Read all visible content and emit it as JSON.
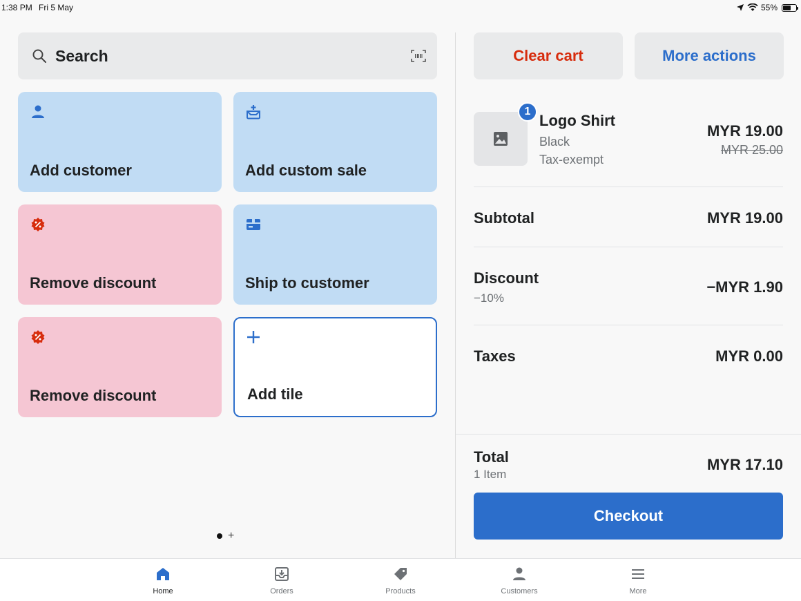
{
  "status_bar": {
    "time": "1:38 PM",
    "date": "Fri 5 May",
    "battery": "55%"
  },
  "search": {
    "label": "Search"
  },
  "tiles": [
    {
      "label": "Add customer",
      "color": "#c1dcf4",
      "icon": "person-icon"
    },
    {
      "label": "Add custom sale",
      "color": "#c1dcf4",
      "icon": "add-to-basket-icon"
    },
    {
      "label": "Remove discount",
      "color": "#f5c6d3",
      "icon": "discount-badge-icon"
    },
    {
      "label": "Ship to customer",
      "color": "#c1dcf4",
      "icon": "shipping-icon"
    },
    {
      "label": "Remove discount",
      "color": "#f5c6d3",
      "icon": "discount-badge-icon"
    },
    {
      "label": "Add tile",
      "color": "#ffffff",
      "icon": "plus-icon"
    }
  ],
  "pager": {
    "plus": "+"
  },
  "cart_actions": {
    "clear_cart": "Clear cart",
    "more_actions": "More actions"
  },
  "cart_item": {
    "quantity": "1",
    "name": "Logo Shirt",
    "variant": "Black",
    "tax": "Tax-exempt",
    "price": "MYR 19.00",
    "original_price": "MYR 25.00"
  },
  "summary": {
    "subtotal_label": "Subtotal",
    "subtotal_value": "MYR 19.00",
    "discount_label": "Discount",
    "discount_sub": "−10%",
    "discount_value": "−MYR 1.90",
    "taxes_label": "Taxes",
    "taxes_value": "MYR 0.00",
    "total_label": "Total",
    "total_sub": "1 Item",
    "total_value": "MYR 17.10"
  },
  "checkout": {
    "label": "Checkout"
  },
  "tabs": [
    {
      "label": "Home",
      "icon": "home-icon",
      "active": true
    },
    {
      "label": "Orders",
      "icon": "orders-icon",
      "active": false
    },
    {
      "label": "Products",
      "icon": "tag-icon",
      "active": false
    },
    {
      "label": "Customers",
      "icon": "person-icon",
      "active": false
    },
    {
      "label": "More",
      "icon": "menu-icon",
      "active": false
    }
  ],
  "colors": {
    "primary": "#2c6ecb",
    "critical": "#d72c0d",
    "tile_blue": "#c1dcf4",
    "tile_pink": "#f5c6d3"
  }
}
